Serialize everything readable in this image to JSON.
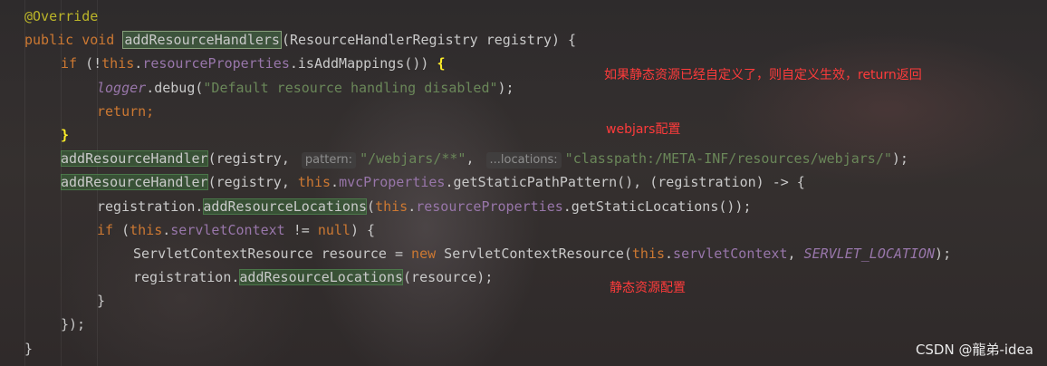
{
  "code_lines": [
    {
      "indent": 0,
      "tokens": [
        {
          "t": "@Override",
          "c": "anno"
        }
      ]
    },
    {
      "indent": 0,
      "tokens": [
        {
          "t": "public void ",
          "c": "kw"
        },
        {
          "t": "addResourceHandlers",
          "c": "decl-hl"
        },
        {
          "t": "(ResourceHandlerRegistry registry) {",
          "c": ""
        }
      ]
    },
    {
      "indent": 1,
      "tokens": [
        {
          "t": "if ",
          "c": "kw"
        },
        {
          "t": "(!",
          "c": ""
        },
        {
          "t": "this",
          "c": "kw"
        },
        {
          "t": ".",
          "c": ""
        },
        {
          "t": "resourceProperties",
          "c": "fld"
        },
        {
          "t": ".isAddMappings()) ",
          "c": ""
        },
        {
          "t": "{",
          "c": "brace-hl"
        }
      ]
    },
    {
      "indent": 2,
      "tokens": [
        {
          "t": "logger",
          "c": "lg"
        },
        {
          "t": ".debug(",
          "c": ""
        },
        {
          "t": "\"Default resource handling disabled\"",
          "c": "str"
        },
        {
          "t": ");",
          "c": ""
        }
      ]
    },
    {
      "indent": 2,
      "tokens": [
        {
          "t": "return;",
          "c": "kw"
        }
      ]
    },
    {
      "indent": 1,
      "tokens": [
        {
          "t": "}",
          "c": "brace-hl"
        }
      ]
    },
    {
      "indent": 1,
      "tokens": [
        {
          "t": "addResourceHandler",
          "c": "ref-hl"
        },
        {
          "t": "(registry, ",
          "c": ""
        },
        {
          "t": "pattern:",
          "c": "hint"
        },
        {
          "t": "\"/webjars/**\"",
          "c": "str"
        },
        {
          "t": ", ",
          "c": ""
        },
        {
          "t": "...locations:",
          "c": "hint"
        },
        {
          "t": "\"classpath:/META-INF/resources/webjars/\"",
          "c": "str"
        },
        {
          "t": ");",
          "c": ""
        }
      ]
    },
    {
      "indent": 1,
      "tokens": [
        {
          "t": "addResourceHandler",
          "c": "ref-hl"
        },
        {
          "t": "(registry, ",
          "c": ""
        },
        {
          "t": "this",
          "c": "kw"
        },
        {
          "t": ".",
          "c": ""
        },
        {
          "t": "mvcProperties",
          "c": "fld"
        },
        {
          "t": ".getStaticPathPattern(), (registration) -> {",
          "c": ""
        }
      ]
    },
    {
      "indent": 2,
      "tokens": [
        {
          "t": "registration.",
          "c": ""
        },
        {
          "t": "addResourceLocations",
          "c": "ref-hl"
        },
        {
          "t": "(",
          "c": ""
        },
        {
          "t": "this",
          "c": "kw"
        },
        {
          "t": ".",
          "c": ""
        },
        {
          "t": "resourceProperties",
          "c": "fld"
        },
        {
          "t": ".getStaticLocations());",
          "c": ""
        }
      ]
    },
    {
      "indent": 2,
      "tokens": [
        {
          "t": "if ",
          "c": "kw"
        },
        {
          "t": "(",
          "c": ""
        },
        {
          "t": "this",
          "c": "kw"
        },
        {
          "t": ".",
          "c": ""
        },
        {
          "t": "servletContext",
          "c": "fld"
        },
        {
          "t": " != ",
          "c": ""
        },
        {
          "t": "null",
          "c": "kw"
        },
        {
          "t": ") {",
          "c": ""
        }
      ]
    },
    {
      "indent": 3,
      "tokens": [
        {
          "t": "ServletContextResource resource = ",
          "c": ""
        },
        {
          "t": "new ",
          "c": "kw"
        },
        {
          "t": "ServletContextResource(",
          "c": ""
        },
        {
          "t": "this",
          "c": "kw"
        },
        {
          "t": ".",
          "c": ""
        },
        {
          "t": "servletContext",
          "c": "fld"
        },
        {
          "t": ", ",
          "c": ""
        },
        {
          "t": "SERVLET_LOCATION",
          "c": "ital"
        },
        {
          "t": ");",
          "c": ""
        }
      ]
    },
    {
      "indent": 3,
      "tokens": [
        {
          "t": "registration.",
          "c": ""
        },
        {
          "t": "addResourceLocations",
          "c": "ref-hl"
        },
        {
          "t": "(resource);",
          "c": ""
        }
      ]
    },
    {
      "indent": 2,
      "tokens": [
        {
          "t": "}",
          "c": ""
        }
      ]
    },
    {
      "indent": 1,
      "tokens": [
        {
          "t": "});",
          "c": ""
        }
      ]
    },
    {
      "indent": 0,
      "tokens": [
        {
          "t": "}",
          "c": ""
        }
      ]
    }
  ],
  "callouts": {
    "custom_config": "如果静态资源已经自定义了，则自定义生效，return返回",
    "webjars_config": "webjars配置",
    "static_config": "静态资源配置"
  },
  "watermark": "CSDN @龍弟-idea"
}
